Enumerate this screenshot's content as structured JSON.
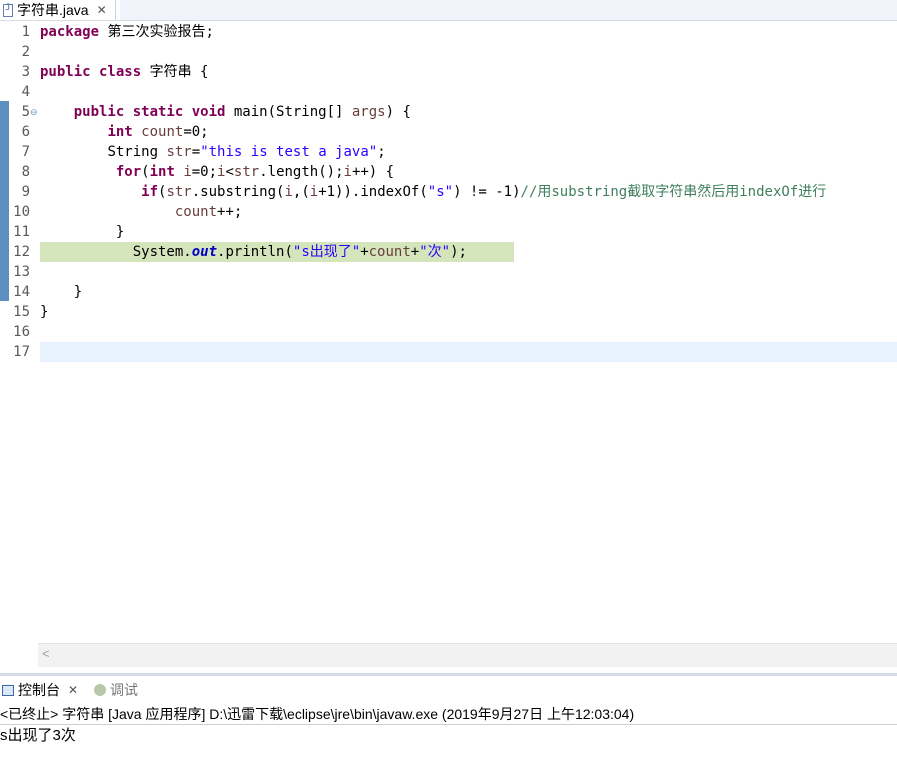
{
  "editor_tab": {
    "filename": "字符串.java",
    "close_icon": "close-icon"
  },
  "code_lines": [
    {
      "num": "1"
    },
    {
      "num": "2"
    },
    {
      "num": "3"
    },
    {
      "num": "4"
    },
    {
      "num": "5"
    },
    {
      "num": "6"
    },
    {
      "num": "7"
    },
    {
      "num": "8"
    },
    {
      "num": "9"
    },
    {
      "num": "10"
    },
    {
      "num": "11"
    },
    {
      "num": "12"
    },
    {
      "num": "13"
    },
    {
      "num": "14"
    },
    {
      "num": "15"
    },
    {
      "num": "16"
    },
    {
      "num": "17"
    }
  ],
  "code": {
    "l1_kw": "package",
    "l1_rest": " 第三次实验报告;",
    "l3_kw": "public class",
    "l3_rest": " 字符串 {",
    "l5_kw": "public static void",
    "l5_rest": " main(String[] ",
    "l5_var": "args",
    "l5_end": ") {",
    "l6_kw": "int",
    "l6_var": " count",
    "l6_end": "=0;",
    "l7_type": "String ",
    "l7_var": "str",
    "l7_eq": "=",
    "l7_str": "\"this is test a java\"",
    "l7_end": ";",
    "l8_kw1": "for",
    "l8_p": "(",
    "l8_kw2": "int",
    "l8_var": " i",
    "l8_a": "=0;",
    "l8_var2": "i",
    "l8_b": "<",
    "l8_var3": "str",
    "l8_c": ".length();",
    "l8_var4": "i",
    "l8_d": "++) {",
    "l9_kw": "if",
    "l9_a": "(",
    "l9_var": "str",
    "l9_b": ".substring(",
    "l9_var2": "i",
    "l9_c": ",(",
    "l9_var3": "i",
    "l9_d": "+1)).indexOf(",
    "l9_str": "\"s\"",
    "l9_e": ") != -1)",
    "l9_cm": "//用substring截取字符串然后用indexOf进行",
    "l10_var": "count",
    "l10_end": "++;",
    "l11": "}",
    "l12_a": "System.",
    "l12_fld": "out",
    "l12_b": ".println(",
    "l12_str1": "\"s出现了\"",
    "l12_c": "+",
    "l12_var": "count",
    "l12_d": "+",
    "l12_str2": "\"次\"",
    "l12_e": ");",
    "l14": "}",
    "l15": "}"
  },
  "console": {
    "tab_console": "控制台",
    "tab_debug": "调试",
    "header": "<已终止> 字符串 [Java 应用程序] D:\\迅雷下载\\eclipse\\jre\\bin\\javaw.exe  (2019年9月27日 上午12:03:04)",
    "output": "s出现了3次"
  },
  "colors": {
    "keyword": "#7f0055",
    "string": "#2a00ff",
    "comment": "#3f7f5f",
    "current_line_highlight": "#d4e4bb",
    "cursor_line": "#e8f2fe"
  }
}
